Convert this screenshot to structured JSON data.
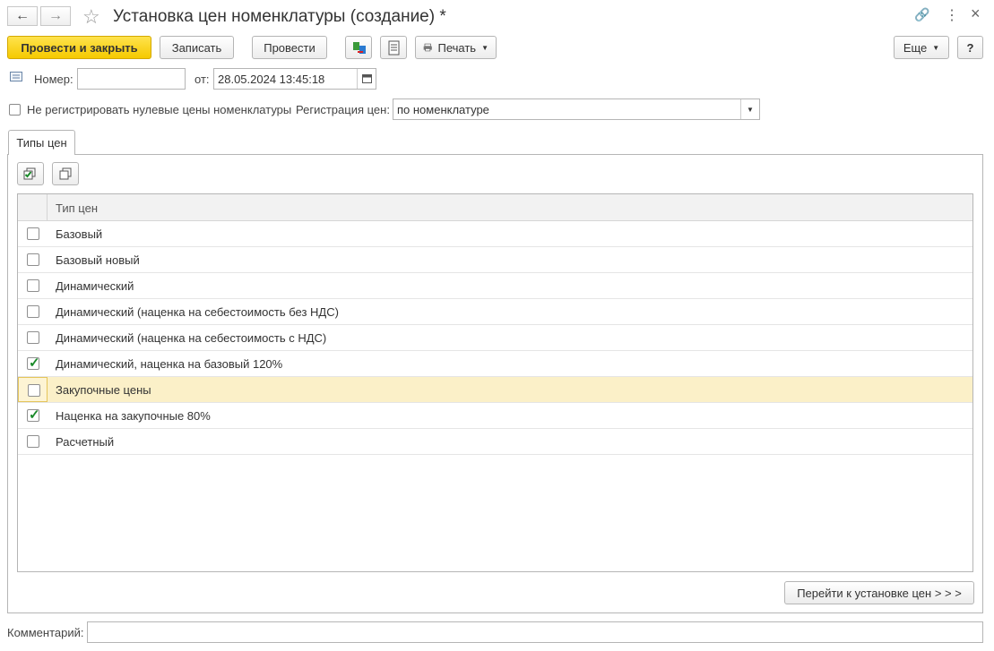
{
  "window": {
    "title": "Установка цен номенклатуры (создание) *",
    "back_icon": "←",
    "forward_icon": "→",
    "star_icon": "☆",
    "link_icon": "🔗",
    "more_icon": "⋮",
    "close_icon": "×"
  },
  "toolbar": {
    "post_close_label": "Провести и закрыть",
    "save_label": "Записать",
    "post_label": "Провести",
    "print_label": "Печать",
    "more_label": "Еще",
    "help_label": "?"
  },
  "header": {
    "number_label": "Номер:",
    "number_value": "",
    "date_label": "от:",
    "date_value": "28.05.2024 13:45:18"
  },
  "options": {
    "no_zero_label": "Не регистрировать нулевые цены номенклатуры",
    "registration_label": "Регистрация цен:",
    "registration_value": "по номенклатуре"
  },
  "tab": {
    "label": "Типы цен"
  },
  "table": {
    "column_header": "Тип цен",
    "rows": [
      {
        "label": "Базовый",
        "checked": false
      },
      {
        "label": "Базовый новый",
        "checked": false
      },
      {
        "label": "Динамический",
        "checked": false
      },
      {
        "label": "Динамический (наценка на себестоимость без НДС)",
        "checked": false
      },
      {
        "label": "Динамический (наценка на себестоимость с НДС)",
        "checked": false
      },
      {
        "label": "Динамический, наценка на базовый 120%",
        "checked": true
      },
      {
        "label": "Закупочные цены",
        "checked": false,
        "selected": true
      },
      {
        "label": "Наценка на закупочные 80%",
        "checked": true
      },
      {
        "label": "Расчетный",
        "checked": false
      }
    ]
  },
  "footer": {
    "goto_label": "Перейти к установке цен > > >",
    "comment_label": "Комментарий:",
    "comment_value": ""
  },
  "colors": {
    "primary_button": "#f5c900",
    "selected_row": "#fbf0c8",
    "check_green": "#1a8a2a"
  }
}
